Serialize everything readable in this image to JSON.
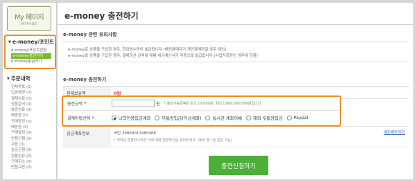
{
  "logo": {
    "title": "My 페이지",
    "subtitle": "MYPAGE"
  },
  "sidebar": {
    "emoney_section": {
      "title": "e-money/포인트",
      "items": [
        {
          "label": "e-money/포인트현황",
          "active": false
        },
        {
          "label": "e-money충전하기",
          "active": true
        },
        {
          "label": "e-money출금하기",
          "active": false
        }
      ]
    },
    "order_section": {
      "title": "주문내역",
      "items": [
        "전체목록 (2)",
        "입금예정 (0)",
        "결제완료 (0)",
        "상품준비 (0)",
        "발송완료 (0)",
        "배송중 (0)",
        "구매확정 (0)",
        "배송중 (0)",
        "구매결정 (0)",
        "반품진행 (0)",
        "교환 (0)",
        "송금진행 (0)",
        "환불완료 (0)",
        "구매취소 (0)",
        "반품교환 (0)"
      ]
    }
  },
  "page": {
    "title": "e-money 충전하기"
  },
  "notice": {
    "heading": "e-money 관련 유의사항",
    "lines": [
      "e-money로 상품을 구입한 경우, 현금영수증이 발급됩니다 (해외판매자가 개인판매자일 경우 제외)",
      "e-money로 상품을 구입한 경우, 결제하신 금액에 대해 세금계산서가 자동으로 발급됩니다 (사업자회원인 경우에 한함)"
    ],
    "link_text": "세금계산서"
  },
  "charge": {
    "heading": "e-money 충전하기",
    "balance_label": "현재보유액",
    "balance_value": "0원",
    "amount_label": "충전금액",
    "amount_unit": "원",
    "amount_note": "* 충전가능금액은 최소 10,000원, 최대 1,000,000,000원입니다.",
    "method_label": "결제방법선택",
    "methods": [
      {
        "label": "나의전용입금계좌",
        "selected": true
      },
      {
        "label": "무통장입금(가상계좌)",
        "selected": false
      },
      {
        "label": "실시간 계좌이체",
        "selected": false
      },
      {
        "label": "해외 무통장입금",
        "selected": false
      },
      {
        "label": "Paypal",
        "selected": false
      }
    ],
    "account_label": "입금계좌정보",
    "account_line1": "국민 39889013485488",
    "account_line2": "* 계좌를 변경하시려면 아래 계좌 변경하기를 눌러주세요. (매주 월~금 입금 가능)",
    "account_change_link": "계좌해지하기",
    "submit_label": "충전신청하기"
  },
  "colors": {
    "accent_orange": "#f08a24",
    "brand_green": "#7cb82f",
    "button_green": "#4caf3a",
    "alert_red": "#e23c3c"
  }
}
